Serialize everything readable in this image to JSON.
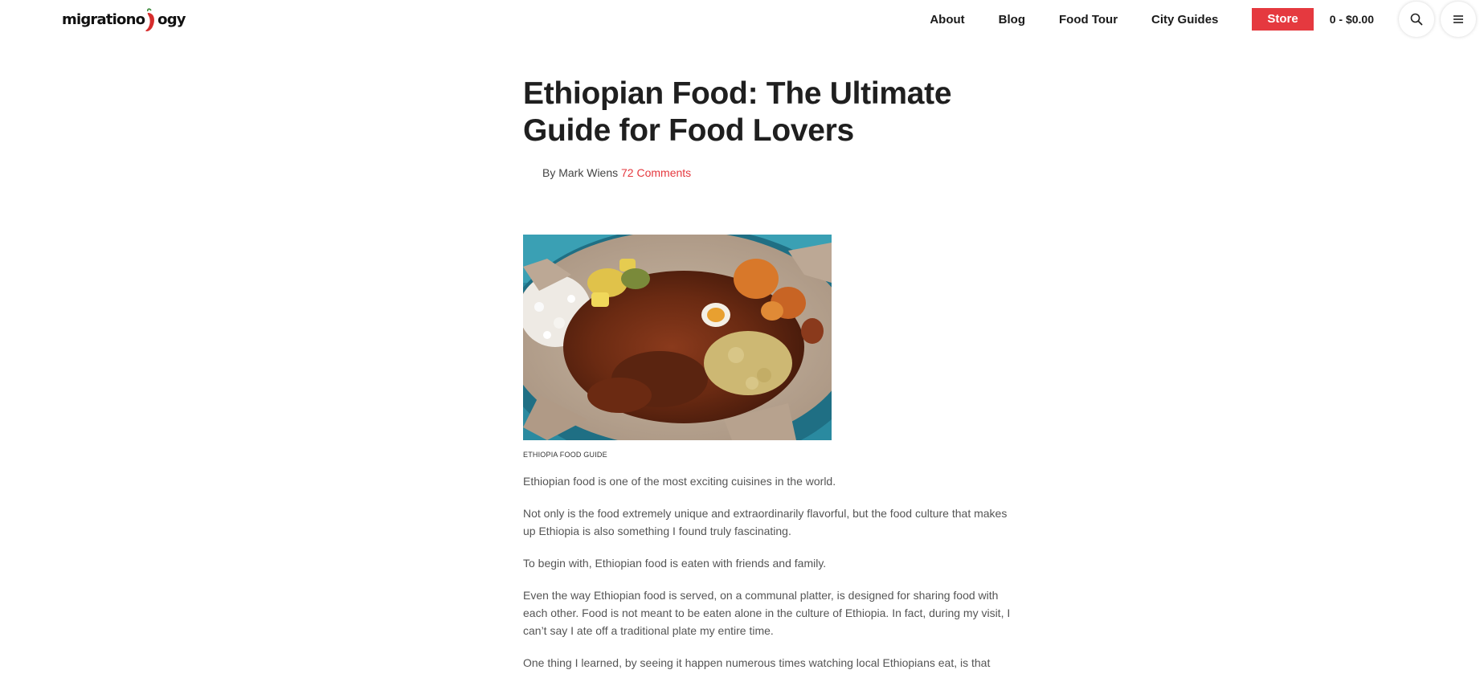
{
  "site": {
    "logo_text_left": "migrationo",
    "logo_text_right": "ogy"
  },
  "nav": {
    "items": [
      {
        "label": "About"
      },
      {
        "label": "Blog"
      },
      {
        "label": "Food Tour"
      },
      {
        "label": "City Guides"
      }
    ],
    "store_label": "Store",
    "cart_text": "0 - $0.00",
    "search_icon": "search-icon",
    "menu_icon": "hamburger-icon"
  },
  "article": {
    "title": "Ethiopian Food: The Ultimate Guide for Food Lovers",
    "byline_prefix": "By Mark Wiens",
    "comments_link": "72 Comments",
    "image_caption": "ETHIOPIA FOOD GUIDE",
    "paragraphs": [
      "Ethiopian food is one of the most exciting cuisines in the world.",
      "Not only is the food extremely unique and extraordinarily flavorful, but the food culture that makes up Ethiopia is also something I found truly fascinating.",
      "To begin with, Ethiopian food is eaten with friends and family.",
      "Even the way Ethiopian food is served, on a communal platter, is designed for sharing food with each other. Food is not meant to be eaten alone in the culture of Ethiopia. In fact, during my visit, I can’t say I ate off a traditional plate my entire time.",
      "One thing I learned, by seeing it happen numerous times watching local Ethiopians eat, is that"
    ]
  },
  "colors": {
    "accent": "#e5393f",
    "text_dark": "#1f1f1f",
    "text_body": "#555555"
  }
}
